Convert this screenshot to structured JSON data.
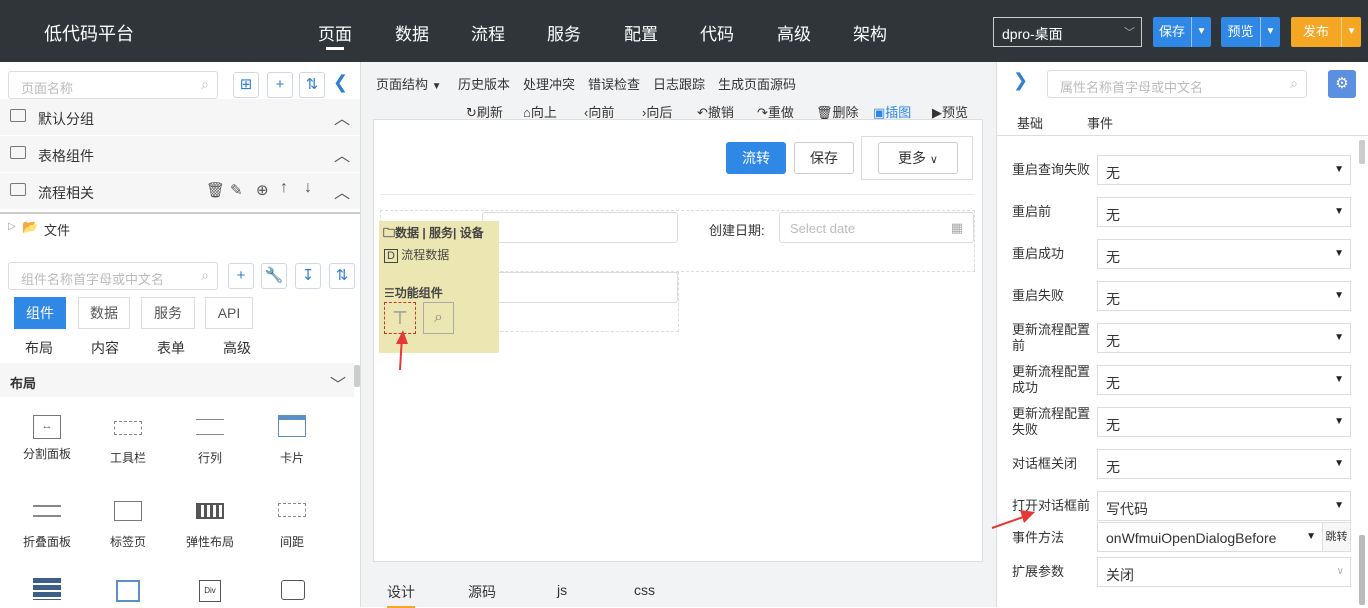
{
  "app": {
    "title": "低代码平台"
  },
  "nav": [
    "页面",
    "数据",
    "流程",
    "服务",
    "配置",
    "代码",
    "高级",
    "架构"
  ],
  "topright": {
    "env": "dpro-桌面",
    "save": "保存",
    "preview": "预览",
    "publish": "发布"
  },
  "left": {
    "page_search_placeholder": "页面名称",
    "groups": [
      "默认分组",
      "表格组件",
      "流程相关"
    ],
    "tree_item": "文件",
    "comp_search_placeholder": "组件名称首字母或中文名",
    "tabs": [
      "组件",
      "数据",
      "服务",
      "API"
    ],
    "subtabs": [
      "布局",
      "内容",
      "表单",
      "高级"
    ],
    "section": "布局",
    "components": [
      "分割面板",
      "工具栏",
      "行列",
      "卡片",
      "折叠面板",
      "标签页",
      "弹性布局",
      "间距"
    ]
  },
  "center": {
    "menu": [
      "页面结构",
      "历史版本",
      "处理冲突",
      "错误检查",
      "日志跟踪",
      "生成页面源码"
    ],
    "tools": [
      "刷新",
      "向上",
      "向前",
      "向后",
      "撤销",
      "重做",
      "删除",
      "插图",
      "预览"
    ],
    "buttons": {
      "flow": "流转",
      "save": "保存",
      "more": "更多"
    },
    "date_label": "创建日期:",
    "date_placeholder": "Select date",
    "popup": {
      "header": "数据 | 服务| 设备",
      "data_item": "流程数据",
      "func": "功能组件"
    },
    "bottom_tabs": [
      "设计",
      "源码",
      "js",
      "css"
    ]
  },
  "right": {
    "search_placeholder": "属性名称首字母或中文名",
    "tabs": [
      "基础",
      "事件"
    ],
    "rows": [
      {
        "label": "重启查询失败",
        "value": "无"
      },
      {
        "label": "重启前",
        "value": "无"
      },
      {
        "label": "重启成功",
        "value": "无"
      },
      {
        "label": "重启失败",
        "value": "无"
      },
      {
        "label": "更新流程配置前",
        "value": "无"
      },
      {
        "label": "更新流程配置成功",
        "value": "无"
      },
      {
        "label": "更新流程配置失败",
        "value": "无"
      },
      {
        "label": "对话框关闭",
        "value": "无"
      },
      {
        "label": "打开对话框前",
        "value": "写代码"
      }
    ],
    "method_label": "事件方法",
    "method_value": "onWfmuiOpenDialogBefore",
    "jump": "跳转",
    "ext_label": "扩展参数",
    "ext_value": "关闭"
  },
  "colors": {
    "topbar": "#2f3538",
    "primary": "#2f87e6",
    "publish": "#f5a623",
    "arrow": "#e53935"
  }
}
